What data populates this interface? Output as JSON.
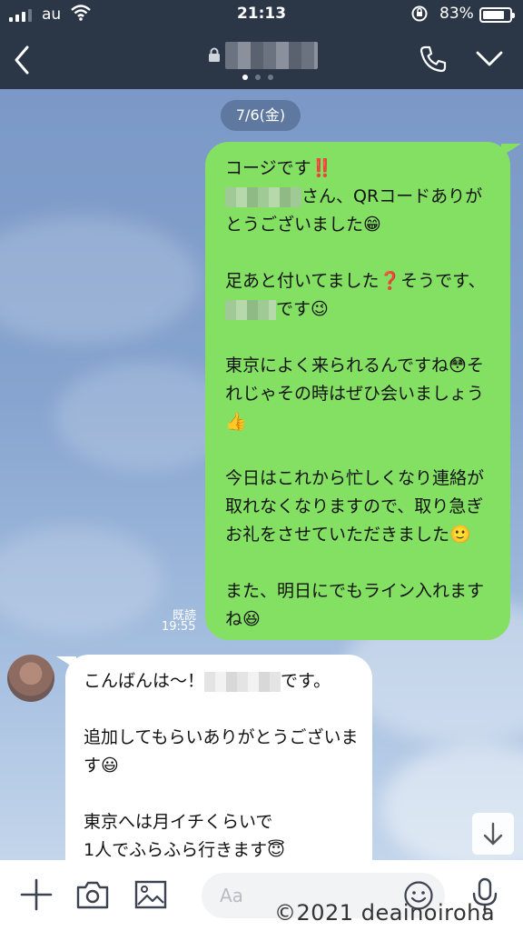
{
  "status_bar": {
    "carrier": "au",
    "time": "21:13",
    "battery_percent": "83%",
    "battery_level": 0.83
  },
  "nav": {
    "contact_name": "■■■■■",
    "page_count": 3,
    "active_page": 0
  },
  "chat": {
    "date": "7/6(金)",
    "outgoing": {
      "read_label": "既読",
      "time": "19:55",
      "paragraphs": [
        [
          "コージです‼️",
          "さん、QRコードありがとうございました😁"
        ],
        [
          "足あと付いてました❓そうです、",
          "です😉"
        ],
        [
          "東京によく来られるんですね😳それじゃその時はぜひ会いましょう👍"
        ],
        [
          "今日はこれから忙しくなり連絡が取れなくなりますので、取り急ぎお礼をさせていただきました🙂"
        ],
        [
          "また、明日にでもライン入れますね😆"
        ]
      ]
    },
    "incoming": {
      "paragraphs": [
        [
          "こんばんは〜！",
          "です。"
        ],
        [
          "追加してもらいありがとうございます😃"
        ],
        [
          "東京へは月イチくらいで",
          "1人でふらふら行きます😇"
        ]
      ]
    }
  },
  "toolbar": {
    "input_placeholder": "Aa"
  },
  "watermark": "©2021 deainoiroha",
  "colors": {
    "header_bg": "#2b3647",
    "outgoing_bubble": "#84e063",
    "incoming_bubble": "#ffffff",
    "chat_bg": "#7f9cc9"
  }
}
